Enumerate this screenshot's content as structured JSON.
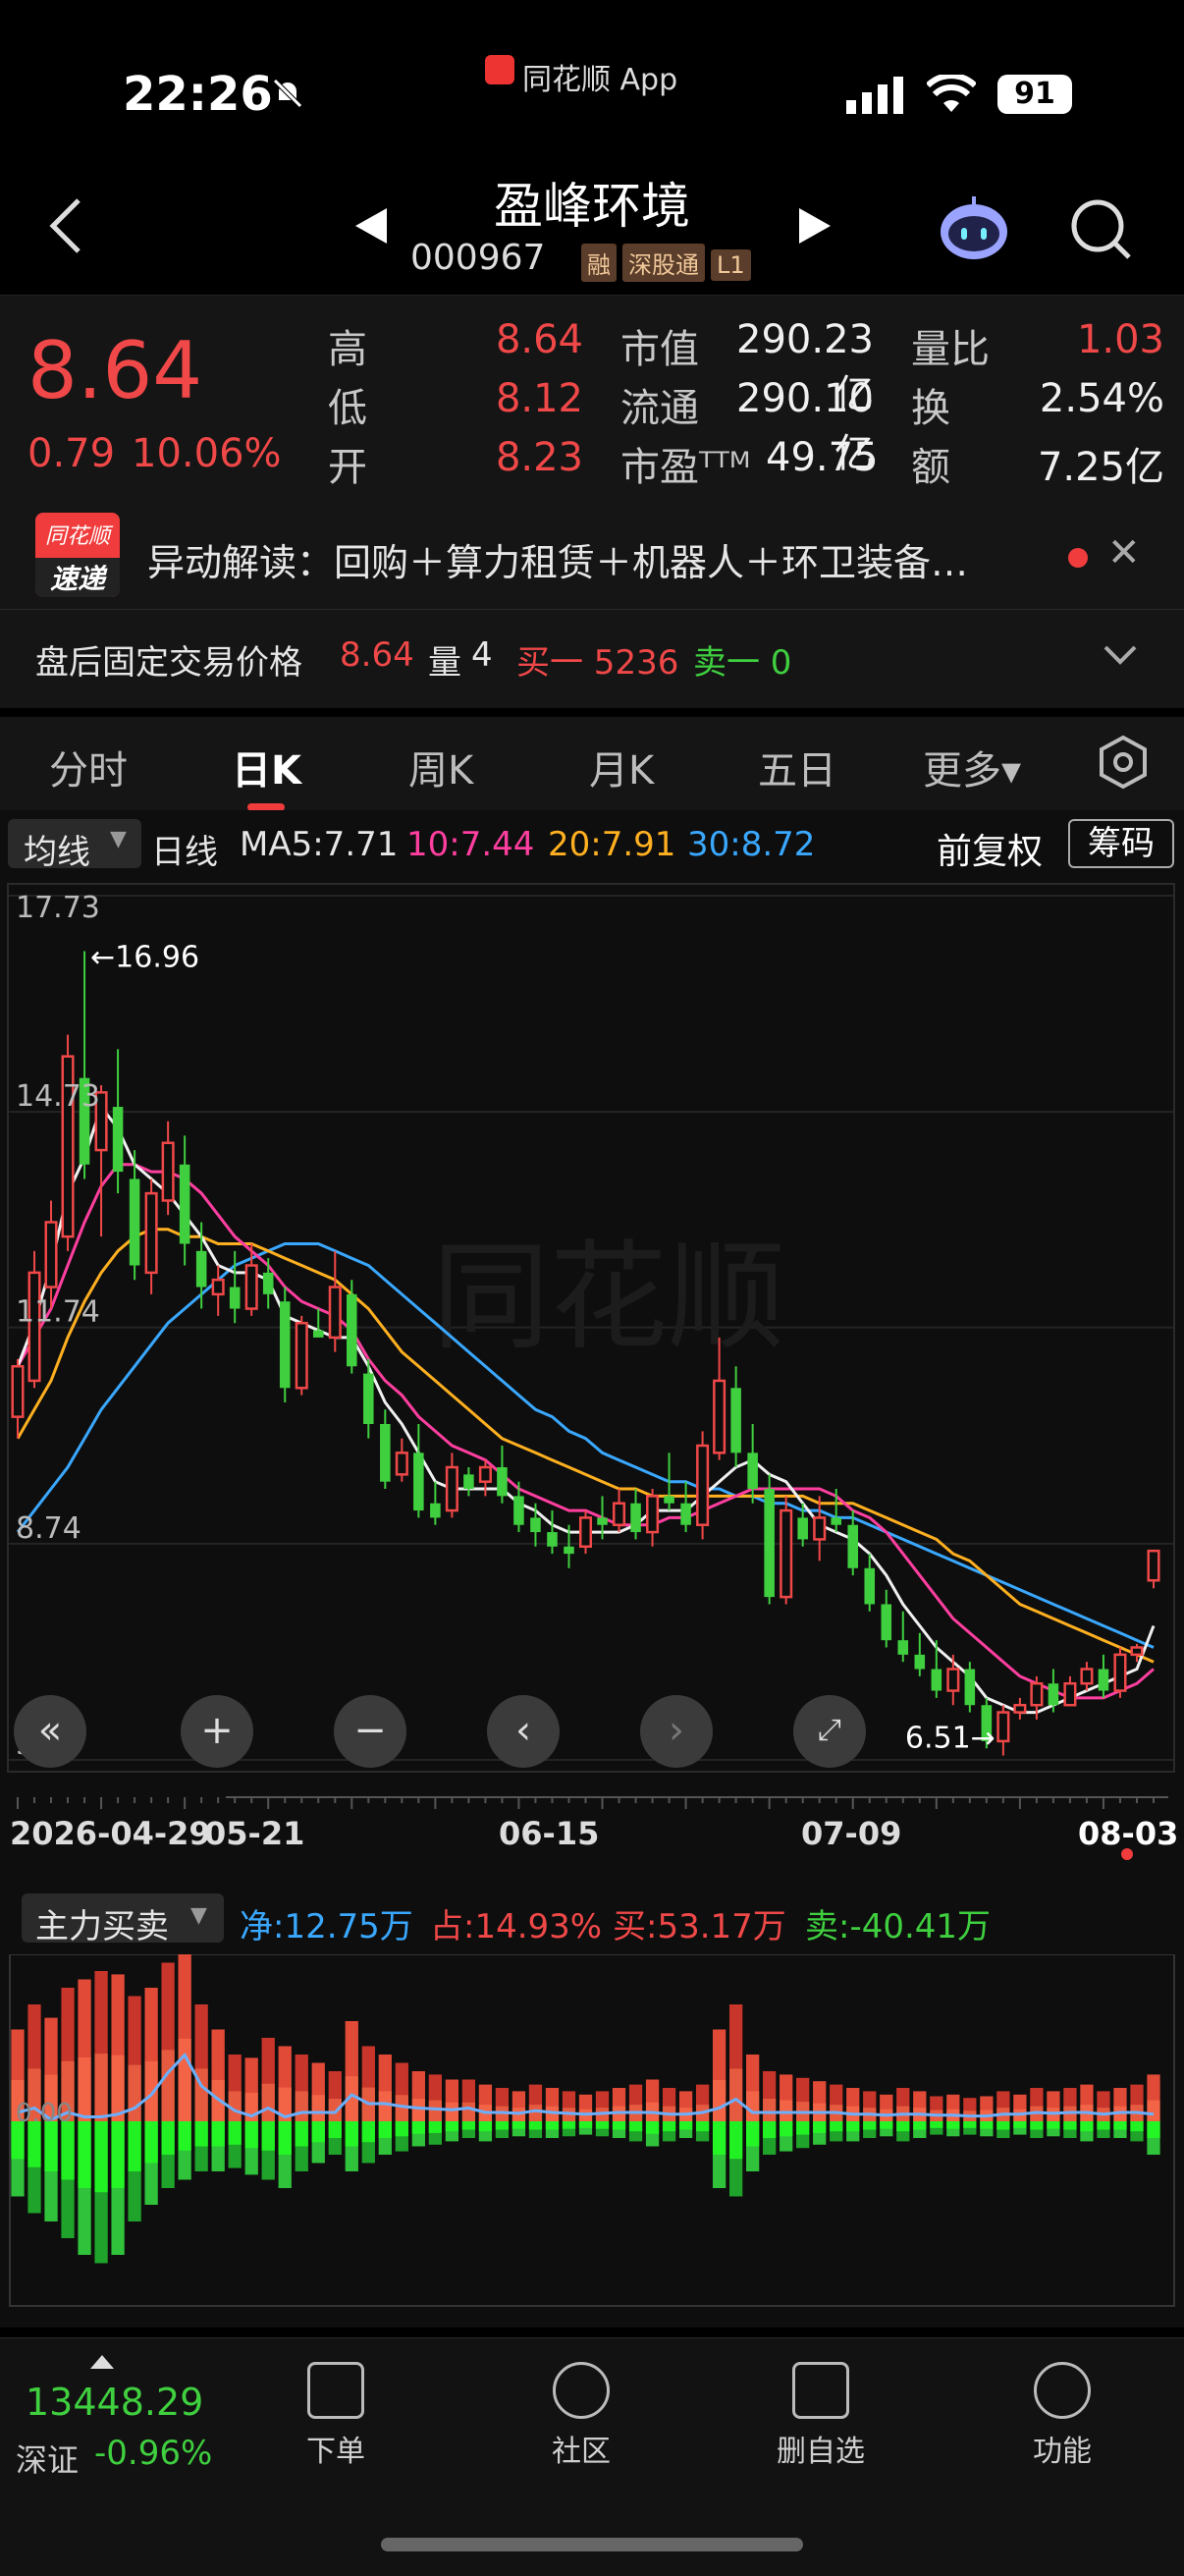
{
  "status_bar": {
    "time": "22:26",
    "app_name": "同花顺 App",
    "battery": "91"
  },
  "header": {
    "title": "盈峰环境",
    "code": "000967",
    "tags": [
      "融",
      "深股通",
      "L1"
    ]
  },
  "quote": {
    "price": "8.64",
    "change": "0.79",
    "change_pct": "10.06%",
    "stats": [
      {
        "label": "高",
        "value": "8.64",
        "color": "#f04848"
      },
      {
        "label": "低",
        "value": "8.12",
        "color": "#f04848"
      },
      {
        "label": "开",
        "value": "8.23",
        "color": "#f04848"
      },
      {
        "label": "市值",
        "value": "290.23亿",
        "color": "#f0f0f0"
      },
      {
        "label": "流通",
        "value": "290.10亿",
        "color": "#f0f0f0"
      },
      {
        "label": "市盈ᵀᵀᴹ",
        "value": "49.75",
        "color": "#f0f0f0"
      },
      {
        "label": "量比",
        "value": "1.03",
        "color": "#f04848"
      },
      {
        "label": "换",
        "value": "2.54%",
        "color": "#f0f0f0"
      },
      {
        "label": "额",
        "value": "7.25亿",
        "color": "#f0f0f0"
      }
    ]
  },
  "alert": {
    "badge_top": "同花顺",
    "badge_bottom": "速递",
    "text": "异动解读：回购＋算力租赁＋机器人＋环卫装备…"
  },
  "after_hours": {
    "label": "盘后固定交易价格",
    "price": "8.64",
    "vol_label": "量",
    "vol": "4",
    "buy1": "买一 5236",
    "sell1": "卖一 0"
  },
  "tabs": [
    "分时",
    "日K",
    "周K",
    "月K",
    "五日",
    "更多▾"
  ],
  "indicator_row": {
    "selector": "均线",
    "period": "日线",
    "ma5": "MA5:7.71",
    "ma10": "10:7.44",
    "ma20": "20:7.91",
    "ma30": "30:8.72",
    "adjust": "前复权",
    "chips": "筹码"
  },
  "colors": {
    "up": "#f04848",
    "down": "#3fcf3f",
    "ma5": "#f0f0f0",
    "ma10": "#ff3fa0",
    "ma20": "#ffb020",
    "ma30": "#3aa8ff"
  },
  "chart_data": {
    "type": "candlestick",
    "y_ticks": [
      "17.73",
      "14.73",
      "11.74",
      "8.74",
      "5.74"
    ],
    "x_ticks": [
      "2026-04-29",
      "05-21",
      "06-15",
      "07-09",
      "08-03"
    ],
    "ylim": [
      5.74,
      17.73
    ],
    "high_marker": "16.96",
    "low_marker": "6.51",
    "candles": [
      [
        10.5,
        11.3,
        10.2,
        11.2
      ],
      [
        11.0,
        12.8,
        10.9,
        12.5
      ],
      [
        12.3,
        13.5,
        12.0,
        13.2
      ],
      [
        13.0,
        15.8,
        12.8,
        15.5
      ],
      [
        15.2,
        16.96,
        13.8,
        14.0
      ],
      [
        14.2,
        15.1,
        13.0,
        15.0
      ],
      [
        14.8,
        15.6,
        13.6,
        13.9
      ],
      [
        13.8,
        14.2,
        12.4,
        12.6
      ],
      [
        12.5,
        13.8,
        12.2,
        13.6
      ],
      [
        13.5,
        14.6,
        13.3,
        14.3
      ],
      [
        14.0,
        14.4,
        12.6,
        12.9
      ],
      [
        12.8,
        13.2,
        12.0,
        12.3
      ],
      [
        12.2,
        12.6,
        11.9,
        12.4
      ],
      [
        12.3,
        12.8,
        11.8,
        12.0
      ],
      [
        12.0,
        12.9,
        11.9,
        12.6
      ],
      [
        12.5,
        12.7,
        12.0,
        12.2
      ],
      [
        12.1,
        12.3,
        10.7,
        10.9
      ],
      [
        10.9,
        11.9,
        10.8,
        11.8
      ],
      [
        11.7,
        12.0,
        11.6,
        11.6
      ],
      [
        11.6,
        12.8,
        11.4,
        12.3
      ],
      [
        12.2,
        12.4,
        11.1,
        11.2
      ],
      [
        11.1,
        11.3,
        10.2,
        10.4
      ],
      [
        10.4,
        10.6,
        9.5,
        9.6
      ],
      [
        9.7,
        10.2,
        9.6,
        10.0
      ],
      [
        10.0,
        10.4,
        9.1,
        9.2
      ],
      [
        9.3,
        9.6,
        9.0,
        9.1
      ],
      [
        9.2,
        10.0,
        9.1,
        9.8
      ],
      [
        9.7,
        9.8,
        9.4,
        9.5
      ],
      [
        9.6,
        9.9,
        9.4,
        9.8
      ],
      [
        9.8,
        10.1,
        9.3,
        9.4
      ],
      [
        9.4,
        9.6,
        8.9,
        9.0
      ],
      [
        9.1,
        9.3,
        8.7,
        8.9
      ],
      [
        8.9,
        9.2,
        8.6,
        8.7
      ],
      [
        8.7,
        9.0,
        8.4,
        8.6
      ],
      [
        8.7,
        9.2,
        8.6,
        9.1
      ],
      [
        9.1,
        9.4,
        8.8,
        9.0
      ],
      [
        9.0,
        9.5,
        8.9,
        9.3
      ],
      [
        9.3,
        9.5,
        8.8,
        8.9
      ],
      [
        8.9,
        9.5,
        8.7,
        9.4
      ],
      [
        9.4,
        10.0,
        9.2,
        9.3
      ],
      [
        9.3,
        9.6,
        8.9,
        9.0
      ],
      [
        9.0,
        10.3,
        8.8,
        10.1
      ],
      [
        10.0,
        11.6,
        9.9,
        11.0
      ],
      [
        10.9,
        11.2,
        9.8,
        10.0
      ],
      [
        10.0,
        10.4,
        9.3,
        9.5
      ],
      [
        9.5,
        9.7,
        7.9,
        8.0
      ],
      [
        8.0,
        9.4,
        7.9,
        9.2
      ],
      [
        9.1,
        9.3,
        8.7,
        8.8
      ],
      [
        8.8,
        9.4,
        8.5,
        9.1
      ],
      [
        9.1,
        9.5,
        8.9,
        9.0
      ],
      [
        9.0,
        9.2,
        8.3,
        8.4
      ],
      [
        8.4,
        8.6,
        7.8,
        7.9
      ],
      [
        7.9,
        8.1,
        7.3,
        7.4
      ],
      [
        7.4,
        7.8,
        7.1,
        7.2
      ],
      [
        7.2,
        7.5,
        6.9,
        7.0
      ],
      [
        7.0,
        7.4,
        6.6,
        6.7
      ],
      [
        6.7,
        7.2,
        6.5,
        7.0
      ],
      [
        7.0,
        7.1,
        6.4,
        6.5
      ],
      [
        6.5,
        6.6,
        5.9,
        6.0
      ],
      [
        6.0,
        6.5,
        5.8,
        6.4
      ],
      [
        6.4,
        6.6,
        6.3,
        6.5
      ],
      [
        6.5,
        6.9,
        6.3,
        6.8
      ],
      [
        6.8,
        7.0,
        6.4,
        6.5
      ],
      [
        6.5,
        6.9,
        6.5,
        6.8
      ],
      [
        6.8,
        7.1,
        6.7,
        7.0
      ],
      [
        7.0,
        7.2,
        6.6,
        6.7
      ],
      [
        6.7,
        7.3,
        6.6,
        7.2
      ],
      [
        7.2,
        7.35,
        7.1,
        7.3
      ],
      [
        8.23,
        8.64,
        8.12,
        8.64
      ]
    ],
    "ma_lines": {
      "ma5": [
        11.2,
        11.8,
        12.6,
        13.6,
        14.1,
        14.8,
        14.5,
        14.0,
        13.8,
        13.6,
        13.3,
        13.0,
        12.6,
        12.5,
        12.5,
        12.4,
        11.9,
        11.8,
        11.7,
        11.6,
        11.6,
        11.2,
        10.7,
        10.4,
        10.0,
        9.6,
        9.5,
        9.5,
        9.5,
        9.5,
        9.3,
        9.2,
        9.0,
        8.9,
        8.9,
        8.9,
        8.9,
        9.0,
        9.2,
        9.2,
        9.2,
        9.4,
        9.6,
        9.8,
        9.9,
        9.7,
        9.6,
        9.3,
        9.0,
        8.9,
        8.8,
        8.6,
        8.3,
        7.9,
        7.6,
        7.3,
        7.1,
        6.9,
        6.6,
        6.5,
        6.4,
        6.4,
        6.5,
        6.6,
        6.7,
        6.8,
        6.9,
        7.0,
        7.6
      ],
      "ma10": [
        11.2,
        11.6,
        12.0,
        12.6,
        13.2,
        13.7,
        14.0,
        14.0,
        13.9,
        13.9,
        13.8,
        13.6,
        13.3,
        13.0,
        12.8,
        12.6,
        12.3,
        12.1,
        12.0,
        11.9,
        11.7,
        11.3,
        11.0,
        10.8,
        10.5,
        10.3,
        10.1,
        10.0,
        9.9,
        9.7,
        9.5,
        9.4,
        9.3,
        9.2,
        9.2,
        9.1,
        9.0,
        9.0,
        9.0,
        9.1,
        9.1,
        9.2,
        9.3,
        9.4,
        9.5,
        9.5,
        9.5,
        9.5,
        9.5,
        9.4,
        9.2,
        9.1,
        8.9,
        8.6,
        8.3,
        8.0,
        7.7,
        7.5,
        7.3,
        7.1,
        6.9,
        6.8,
        6.7,
        6.6,
        6.6,
        6.6,
        6.7,
        6.8,
        7.0
      ],
      "ma20": [
        10.2,
        10.6,
        11.0,
        11.6,
        12.1,
        12.5,
        12.8,
        13.0,
        13.1,
        13.1,
        13.0,
        13.0,
        12.9,
        12.9,
        12.9,
        12.8,
        12.7,
        12.6,
        12.5,
        12.4,
        12.2,
        12.0,
        11.7,
        11.4,
        11.2,
        11.0,
        10.8,
        10.6,
        10.4,
        10.2,
        10.1,
        10.0,
        9.9,
        9.8,
        9.7,
        9.6,
        9.5,
        9.5,
        9.4,
        9.4,
        9.4,
        9.4,
        9.4,
        9.4,
        9.4,
        9.4,
        9.4,
        9.4,
        9.3,
        9.3,
        9.3,
        9.2,
        9.1,
        9.0,
        8.9,
        8.8,
        8.6,
        8.5,
        8.3,
        8.1,
        7.9,
        7.8,
        7.7,
        7.6,
        7.5,
        7.4,
        7.3,
        7.2,
        7.1
      ],
      "ma30": [
        8.9,
        9.2,
        9.5,
        9.8,
        10.2,
        10.6,
        10.9,
        11.2,
        11.5,
        11.8,
        12.0,
        12.2,
        12.4,
        12.6,
        12.7,
        12.8,
        12.9,
        12.9,
        12.9,
        12.8,
        12.7,
        12.6,
        12.4,
        12.2,
        12.0,
        11.8,
        11.6,
        11.4,
        11.2,
        11.0,
        10.8,
        10.6,
        10.5,
        10.3,
        10.2,
        10.0,
        9.9,
        9.8,
        9.7,
        9.6,
        9.6,
        9.5,
        9.5,
        9.4,
        9.4,
        9.3,
        9.3,
        9.2,
        9.2,
        9.1,
        9.1,
        9.0,
        8.9,
        8.8,
        8.7,
        8.6,
        8.5,
        8.4,
        8.3,
        8.2,
        8.1,
        8.0,
        7.9,
        7.8,
        7.7,
        7.6,
        7.5,
        7.4,
        7.3
      ]
    }
  },
  "flow_panel": {
    "selector": "主力买卖",
    "net": "净:12.75万",
    "share": "占:14.93%",
    "buy": "买:53.17万",
    "sell": "卖:-40.41万",
    "zero_label": "0.00",
    "buy_series": [
      55,
      70,
      62,
      80,
      85,
      90,
      88,
      75,
      80,
      95,
      110,
      70,
      55,
      40,
      38,
      50,
      45,
      40,
      35,
      30,
      60,
      45,
      40,
      35,
      30,
      28,
      25,
      25,
      22,
      20,
      18,
      22,
      20,
      18,
      16,
      18,
      20,
      22,
      25,
      20,
      18,
      22,
      55,
      70,
      40,
      30,
      28,
      26,
      24,
      22,
      20,
      18,
      16,
      20,
      18,
      15,
      16,
      14,
      15,
      18,
      16,
      20,
      18,
      20,
      22,
      18,
      20,
      22,
      28
    ],
    "sell_series": [
      -45,
      -55,
      -60,
      -70,
      -80,
      -85,
      -80,
      -60,
      -50,
      -40,
      -35,
      -30,
      -30,
      -28,
      -32,
      -35,
      -40,
      -30,
      -25,
      -20,
      -30,
      -25,
      -20,
      -18,
      -15,
      -14,
      -12,
      -10,
      -12,
      -10,
      -9,
      -10,
      -10,
      -9,
      -8,
      -9,
      -10,
      -12,
      -15,
      -12,
      -10,
      -12,
      -40,
      -45,
      -30,
      -20,
      -18,
      -16,
      -14,
      -12,
      -12,
      -10,
      -9,
      -12,
      -10,
      -8,
      -9,
      -8,
      -9,
      -10,
      -8,
      -10,
      -9,
      -10,
      -12,
      -10,
      -10,
      -12,
      -20
    ]
  },
  "bottom_bar": {
    "index_value": "13448.29",
    "index_name": "深证",
    "index_change": "-0.96%",
    "items": [
      "下单",
      "社区",
      "删自选",
      "功能"
    ]
  }
}
